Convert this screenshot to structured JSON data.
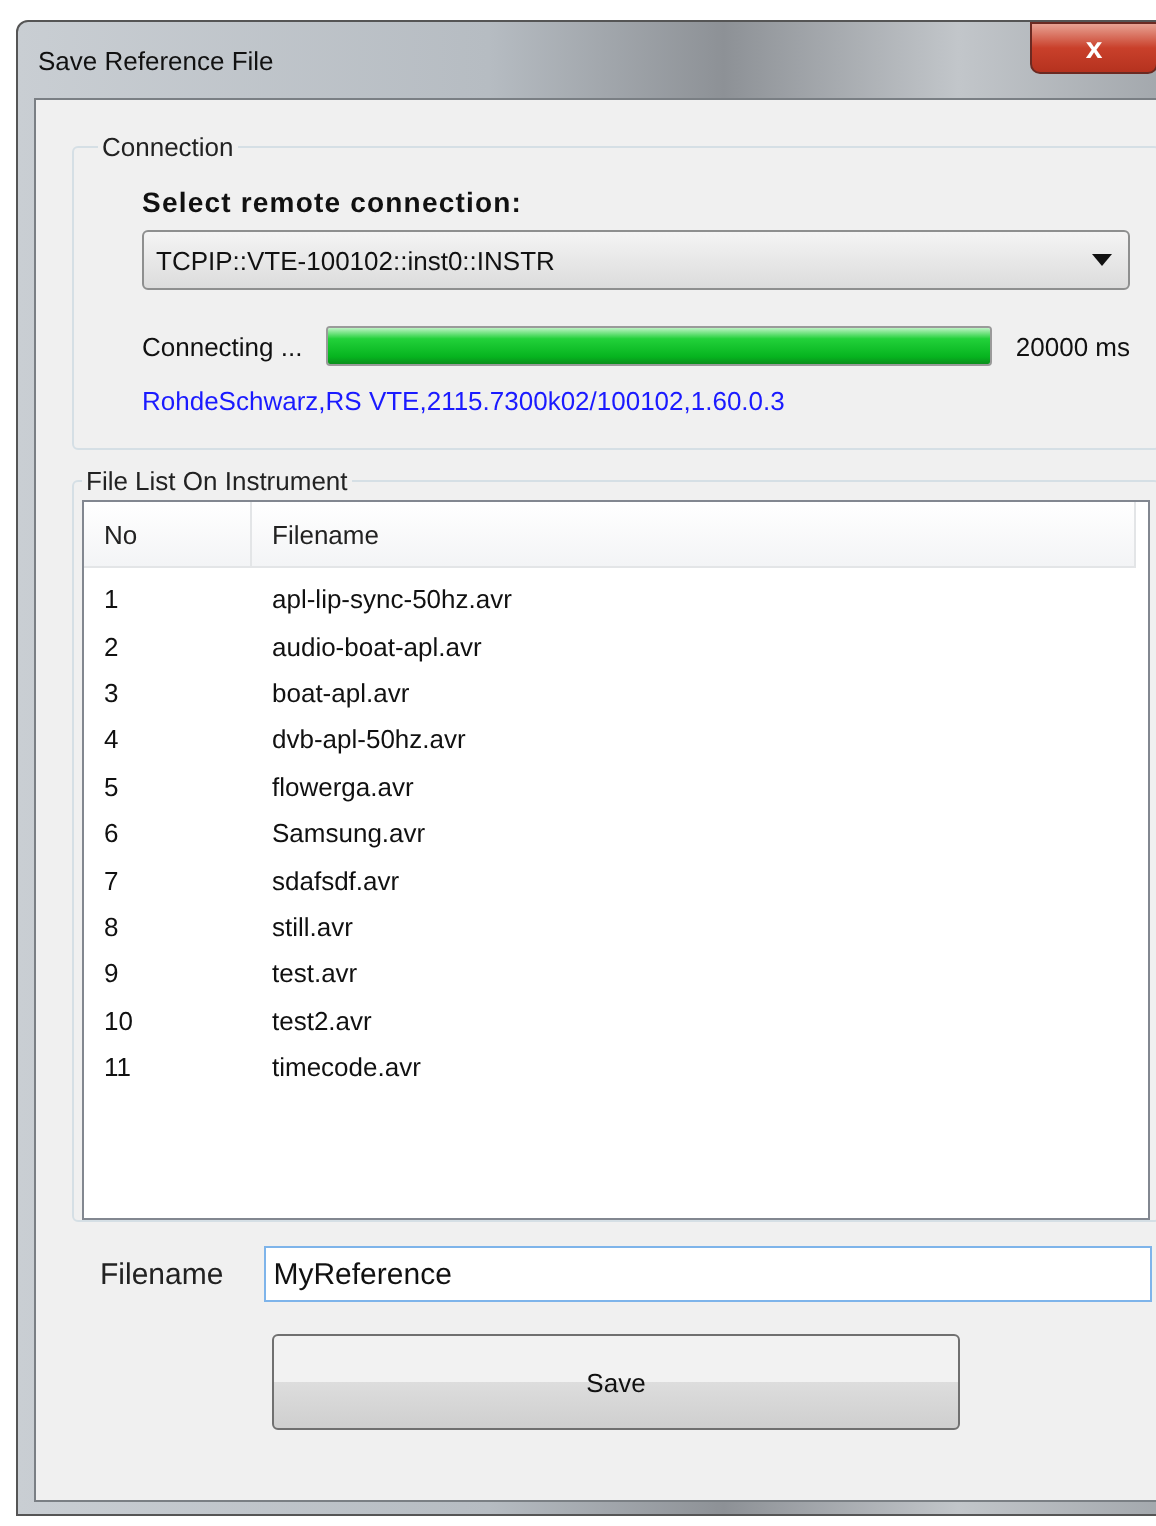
{
  "window": {
    "title": "Save Reference File",
    "close": "x"
  },
  "connection": {
    "legend": "Connection",
    "label": "Select remote connection:",
    "selected_value": "TCPIP::VTE-100102::inst0::INSTR",
    "status": "Connecting ...",
    "level": 1,
    "timeout": "20000 ms",
    "device_id": "RohdeSchwarz,RS VTE,2115.7300k02/100102,1.60.0.3"
  },
  "file_list": {
    "legend": "File List On Instrument",
    "columns": [
      "No",
      "Filename"
    ],
    "rows": [
      [
        "1",
        "apl-lip-sync-50hz.avr"
      ],
      [
        "2",
        "audio-boat-apl.avr"
      ],
      [
        "3",
        "boat-apl.avr"
      ],
      [
        "4",
        "dvb-apl-50hz.avr"
      ],
      [
        "5",
        "flowerga.avr"
      ],
      [
        "6",
        "Samsung.avr"
      ],
      [
        "7",
        "sdafsdf.avr"
      ],
      [
        "8",
        "still.avr"
      ],
      [
        "9",
        "test.avr"
      ],
      [
        "10",
        "test2.avr"
      ],
      [
        "11",
        "timecode.avr"
      ]
    ]
  },
  "filename": {
    "label": "Filename",
    "value": "MyReference"
  },
  "buttons": [
    "Save"
  ]
}
